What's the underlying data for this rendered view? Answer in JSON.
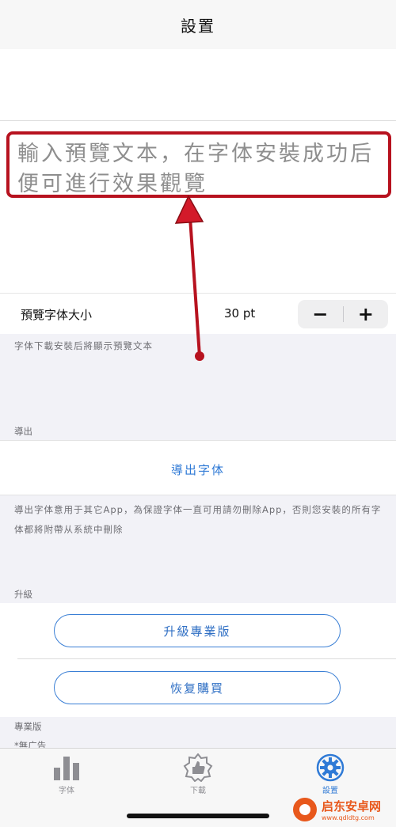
{
  "nav": {
    "title": "設置"
  },
  "preview": {
    "placeholder": "輸入預覽文本，在字体安裝成功后便可進行效果觀覽"
  },
  "size_row": {
    "label": "預覽字体大小",
    "value": "30 pt",
    "minus": "−",
    "plus": "+"
  },
  "preview_hint": "字体下載安裝后將顯示預覽文本",
  "export_section": {
    "header": "導出",
    "button": "導出字体",
    "footer": "導出字体意用于其它App，為保證字体一直可用請勿刪除App，否則您安裝的所有字体都將附帶从系統中刪除"
  },
  "upgrade_section": {
    "header": "升級",
    "upgrade_button": "升級專業版",
    "restore_button": "恢复購買"
  },
  "pro_section": {
    "header": "專業版",
    "item1": "*無广告"
  },
  "tabbar": {
    "tabs": [
      {
        "label": "字体",
        "icon": "bar-chart-icon"
      },
      {
        "label": "下載",
        "icon": "thumbs-up-badge-icon"
      },
      {
        "label": "設置",
        "icon": "gear-icon"
      }
    ],
    "active_color": "#2f7ad6",
    "inactive_color": "#8e8e93"
  },
  "watermark": {
    "name": "启东安卓网",
    "url": "www.qdldtg.com"
  },
  "colors": {
    "annotation_red": "#b7121f",
    "link_blue": "#2f7ad6"
  }
}
